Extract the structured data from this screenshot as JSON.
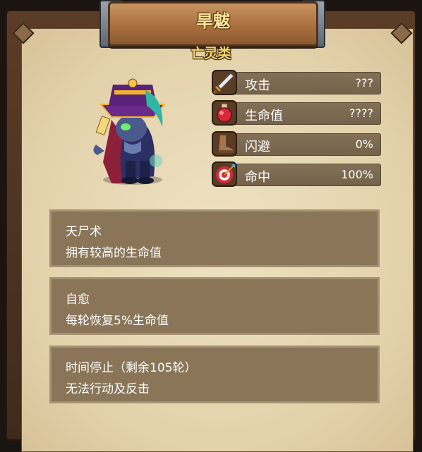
{
  "header": {
    "title": "旱魃",
    "subtitle": "亡灵类"
  },
  "stats": [
    {
      "label": "攻击",
      "value": "???",
      "icon": "sword-icon"
    },
    {
      "label": "生命值",
      "value": "????",
      "icon": "potion-icon"
    },
    {
      "label": "闪避",
      "value": "0%",
      "icon": "boot-icon"
    },
    {
      "label": "命中",
      "value": "100%",
      "icon": "target-icon"
    }
  ],
  "skills": [
    {
      "name": "天尸术",
      "description": "拥有较高的生命值"
    },
    {
      "name": "自愈",
      "description": "每轮恢复5%生命值"
    },
    {
      "name": "时间停止（剩余105轮）",
      "description": "无法行动及反击"
    }
  ],
  "colors": {
    "title": "#ffe79a",
    "subtitle": "#f5d56b",
    "panel": "#8a7558",
    "stat_bar": "#7d6a51"
  }
}
